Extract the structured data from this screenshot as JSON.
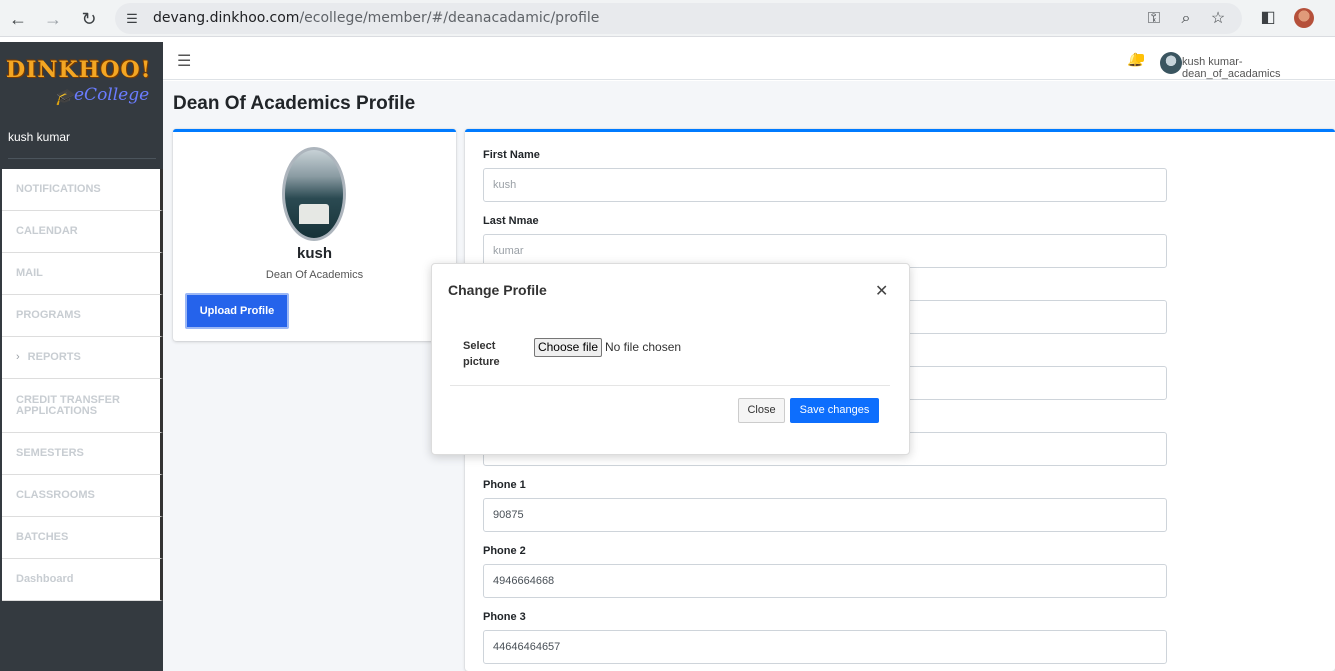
{
  "browser": {
    "url_host": "devang.dinkhoo.com",
    "url_path": "/ecollege/member/#/deanacadamic/profile"
  },
  "sidebar": {
    "logo_main": "DINKHOO!",
    "logo_sub": "eCollege",
    "user_name": "kush kumar",
    "items": [
      {
        "label": "NOTIFICATIONS"
      },
      {
        "label": "CALENDAR"
      },
      {
        "label": "MAIL"
      },
      {
        "label": "PROGRAMS"
      },
      {
        "label": "REPORTS"
      },
      {
        "label": "CREDIT TRANSFER APPLICATIONS"
      },
      {
        "label": "SEMESTERS"
      },
      {
        "label": "CLASSROOMS"
      },
      {
        "label": "BATCHES"
      },
      {
        "label": "Dashboard"
      }
    ]
  },
  "topbar": {
    "user_label": "kush kumar-dean_of_acadamics"
  },
  "page": {
    "title": "Dean Of Academics Profile"
  },
  "profile_card": {
    "name": "kush",
    "role": "Dean Of Academics",
    "upload_label": "Upload Profile"
  },
  "form": {
    "first_name_label": "First Name",
    "first_name_placeholder": "kush",
    "last_name_label": "Last Nmae",
    "last_name_placeholder": "kumar",
    "phone1_label": "Phone 1",
    "phone1_value": "90875",
    "phone2_label": "Phone 2",
    "phone2_value": "4946664668",
    "phone3_label": "Phone 3",
    "phone3_value": "44646464657"
  },
  "modal": {
    "title": "Change Profile",
    "select_label": "Select picture",
    "choose_file_label": "Choose file",
    "file_status": "No file chosen",
    "close_label": "Close",
    "save_label": "Save changes"
  }
}
